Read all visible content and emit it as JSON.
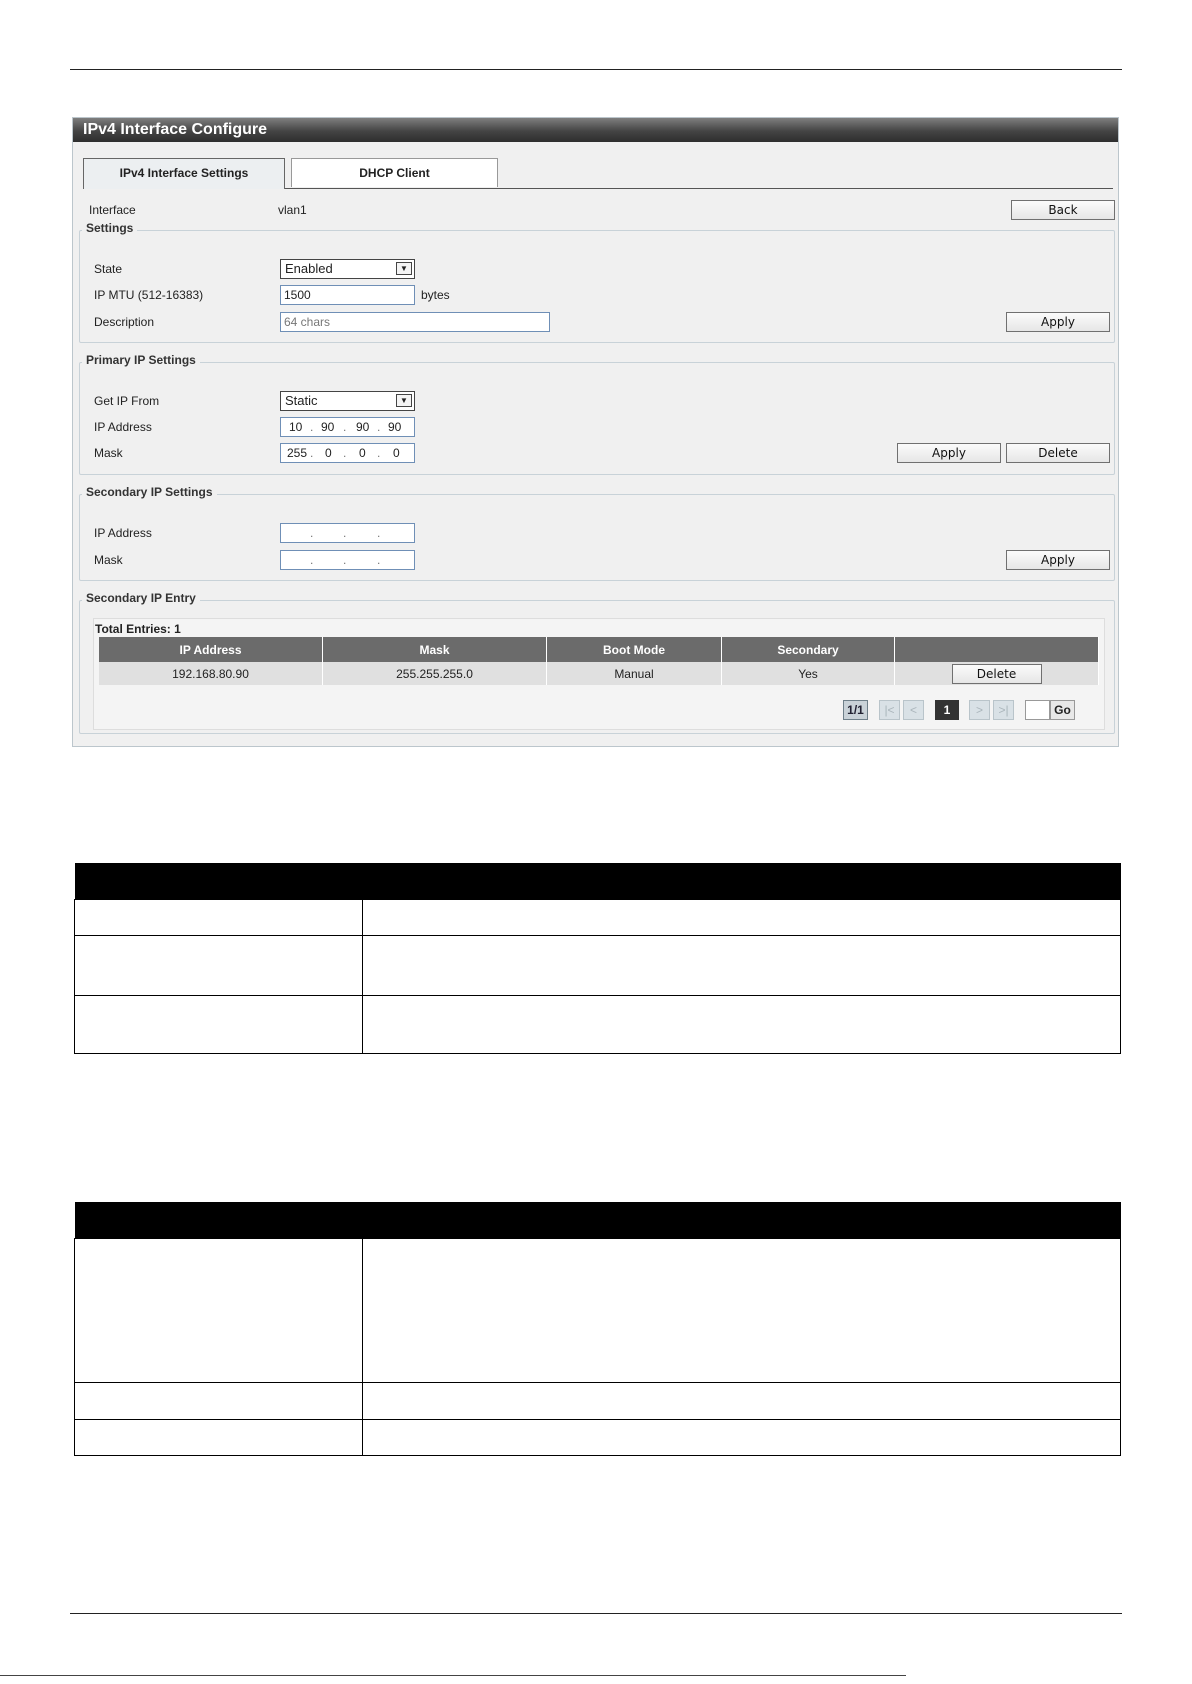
{
  "panel": {
    "title": "IPv4 Interface Configure",
    "tabs": [
      {
        "label": "IPv4 Interface Settings",
        "active": true
      },
      {
        "label": "DHCP Client",
        "active": false
      }
    ],
    "interface_label": "Interface",
    "interface_value": "vlan1",
    "back_label": "Back",
    "settings": {
      "legend": "Settings",
      "state_label": "State",
      "state_value": "Enabled",
      "mtu_label": "IP MTU (512-16383)",
      "mtu_value": "1500",
      "mtu_unit": "bytes",
      "description_label": "Description",
      "description_placeholder": "64 chars",
      "apply_label": "Apply"
    },
    "primary": {
      "legend": "Primary IP Settings",
      "get_ip_label": "Get IP From",
      "get_ip_value": "Static",
      "ip_label": "IP Address",
      "ip_octets": [
        "10",
        "90",
        "90",
        "90"
      ],
      "mask_label": "Mask",
      "mask_octets": [
        "255",
        "0",
        "0",
        "0"
      ],
      "apply_label": "Apply",
      "delete_label": "Delete"
    },
    "secondary": {
      "legend": "Secondary IP Settings",
      "ip_label": "IP Address",
      "mask_label": "Mask",
      "apply_label": "Apply"
    },
    "entry": {
      "legend": "Secondary IP Entry",
      "total": "Total Entries: 1",
      "columns": [
        "IP Address",
        "Mask",
        "Boot Mode",
        "Secondary",
        ""
      ],
      "rows": [
        {
          "ip": "192.168.80.90",
          "mask": "255.255.255.0",
          "boot_mode": "Manual",
          "secondary": "Yes",
          "action": "Delete"
        }
      ],
      "pager": {
        "info": "1/1",
        "first": "|<",
        "prev": "<",
        "current": "1",
        "next": ">",
        "last": ">|",
        "go_label": "Go"
      }
    }
  },
  "colors": {
    "title_bar": "#444444",
    "table_header": "#6b6b6b",
    "doc_header": "#000000"
  }
}
